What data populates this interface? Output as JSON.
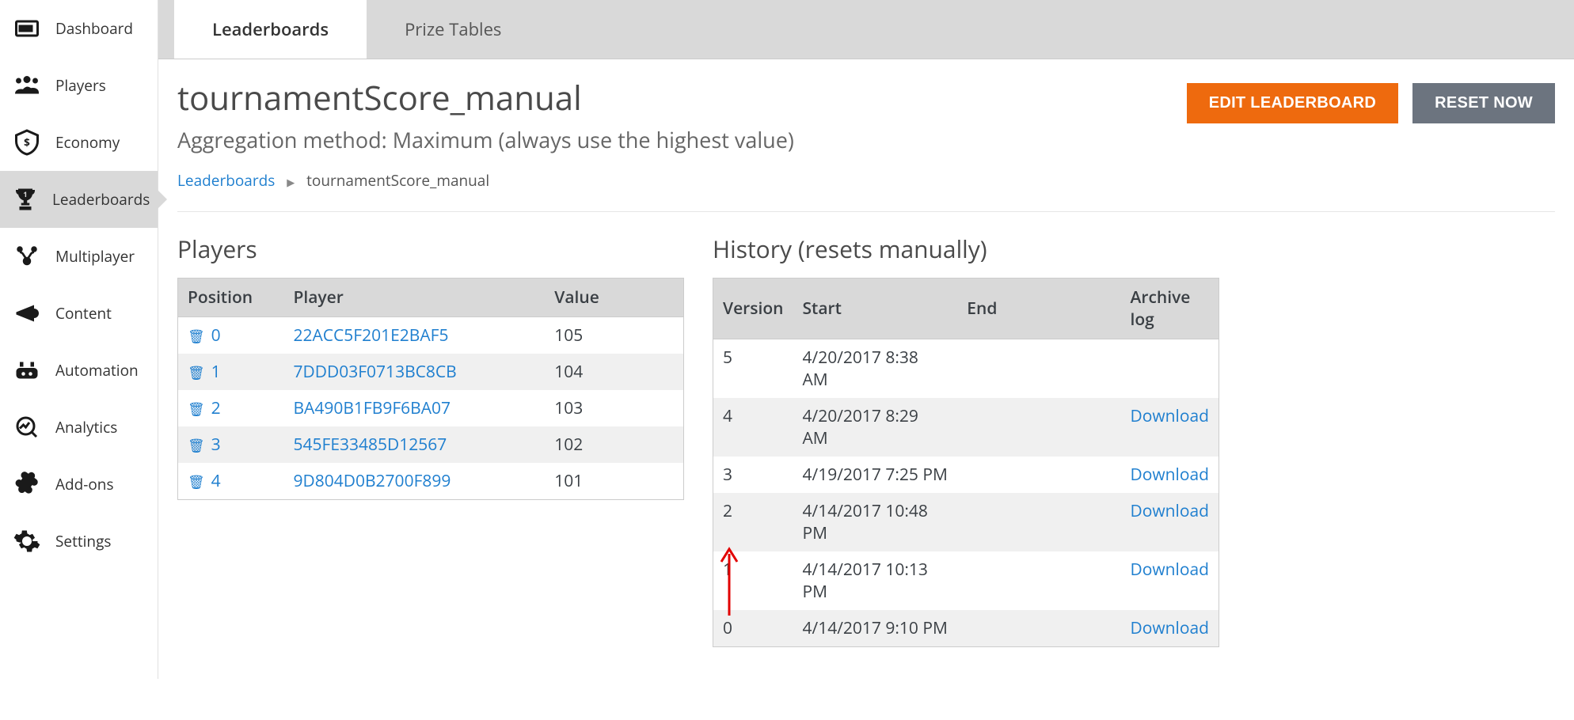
{
  "sidebar": {
    "items": [
      {
        "label": "Dashboard"
      },
      {
        "label": "Players"
      },
      {
        "label": "Economy"
      },
      {
        "label": "Leaderboards"
      },
      {
        "label": "Multiplayer"
      },
      {
        "label": "Content"
      },
      {
        "label": "Automation"
      },
      {
        "label": "Analytics"
      },
      {
        "label": "Add-ons"
      },
      {
        "label": "Settings"
      }
    ]
  },
  "tabs": {
    "leaderboards": "Leaderboards",
    "prize_tables": "Prize Tables"
  },
  "header": {
    "title": "tournamentScore_manual",
    "subtitle": "Aggregation method: Maximum (always use the highest value)",
    "edit_label": "EDIT LEADERBOARD",
    "reset_label": "RESET NOW"
  },
  "breadcrumb": {
    "root": "Leaderboards",
    "current": "tournamentScore_manual"
  },
  "players_panel": {
    "title": "Players",
    "columns": {
      "position": "Position",
      "player": "Player",
      "value": "Value"
    },
    "rows": [
      {
        "position": "0",
        "player": "22ACC5F201E2BAF5",
        "value": "105"
      },
      {
        "position": "1",
        "player": "7DDD03F0713BC8CB",
        "value": "104"
      },
      {
        "position": "2",
        "player": "BA490B1FB9F6BA07",
        "value": "103"
      },
      {
        "position": "3",
        "player": "545FE33485D12567",
        "value": "102"
      },
      {
        "position": "4",
        "player": "9D804D0B2700F899",
        "value": "101"
      }
    ]
  },
  "history_panel": {
    "title": "History (resets manually)",
    "columns": {
      "version": "Version",
      "start": "Start",
      "end": "End",
      "archive": "Archive log"
    },
    "download_label": "Download",
    "rows": [
      {
        "version": "5",
        "start": "4/20/2017 8:38 AM",
        "end": "",
        "download": false
      },
      {
        "version": "4",
        "start": "4/20/2017 8:29 AM",
        "end": "",
        "download": true
      },
      {
        "version": "3",
        "start": "4/19/2017 7:25 PM",
        "end": "",
        "download": true
      },
      {
        "version": "2",
        "start": "4/14/2017 10:48 PM",
        "end": "",
        "download": true
      },
      {
        "version": "1",
        "start": "4/14/2017 10:13 PM",
        "end": "",
        "download": true
      },
      {
        "version": "0",
        "start": "4/14/2017 9:10 PM",
        "end": "",
        "download": true
      }
    ]
  }
}
